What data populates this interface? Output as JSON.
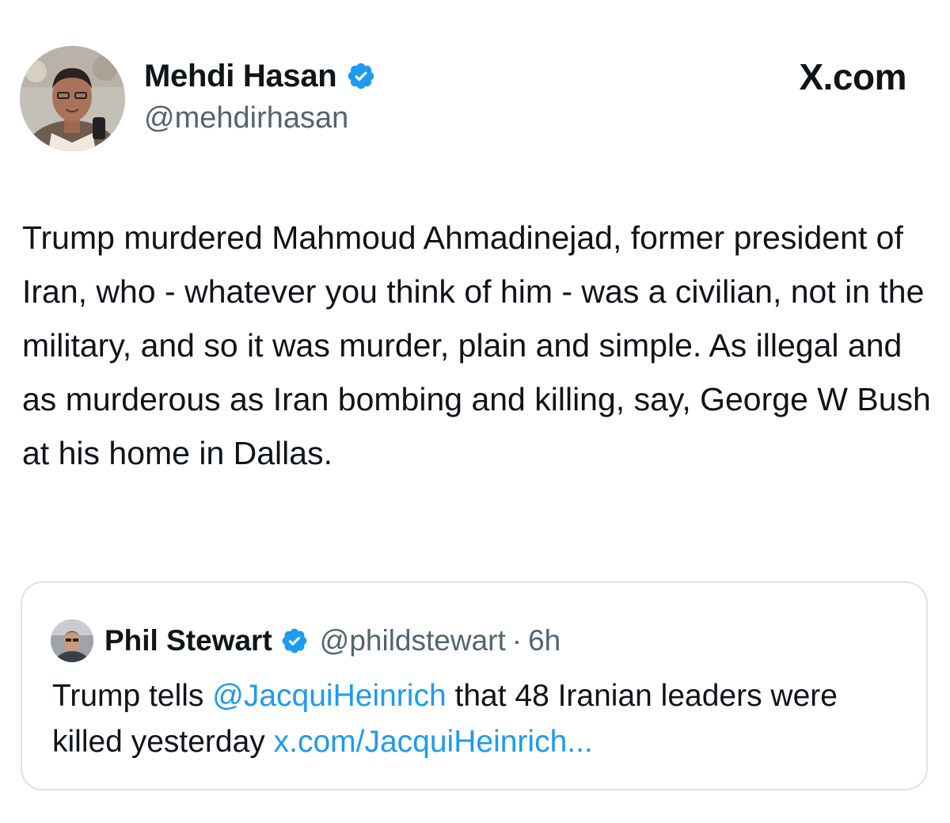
{
  "author": {
    "name": "Mehdi Hasan",
    "handle": "@mehdirhasan",
    "verified_icon": "verified-badge-icon",
    "badge_color": "#1d9bf0"
  },
  "site": {
    "label": "X.com"
  },
  "post": {
    "text": "Trump murdered Mahmoud Ahmadinejad, former president of Iran, who - whatever you think of him - was a civilian, not in the military, and so it was murder, plain and simple. As illegal and as murderous as Iran bombing and killing, say, George W Bush at his home in Dallas."
  },
  "quote": {
    "author_name": "Phil Stewart",
    "handle": "@phildstewart",
    "separator": "·",
    "time": "6h",
    "text_before": "Trump tells ",
    "mention": "@JacquiHeinrich",
    "text_after": " that 48 Iranian leaders were killed yesterday ",
    "link": "x.com/JacquiHeinrich..."
  },
  "colors": {
    "text": "#0f1419",
    "secondary_text": "#536471",
    "link": "#1d9bf0",
    "border": "#dfe3e7"
  }
}
